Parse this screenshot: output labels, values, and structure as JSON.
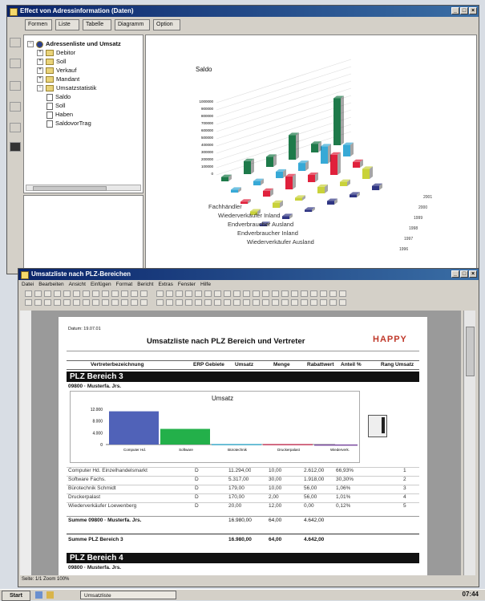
{
  "window1": {
    "title": "Effect von Adressinformation (Daten)",
    "toolbar": [
      "Formen",
      "Liste",
      "Tabelle",
      "Diagramm",
      "Option"
    ],
    "tree": [
      {
        "label": "Adressenliste und Umsatz",
        "level": 0,
        "kind": "root"
      },
      {
        "label": "Debitor",
        "level": 1,
        "kind": "folder"
      },
      {
        "label": "Soll",
        "level": 1,
        "kind": "folder"
      },
      {
        "label": "Verkauf",
        "level": 1,
        "kind": "folder"
      },
      {
        "label": "Mandant",
        "level": 1,
        "kind": "folder"
      },
      {
        "label": "Umsatzstatistik",
        "level": 1,
        "kind": "folder"
      },
      {
        "label": "Saldo",
        "level": 2,
        "kind": "doc"
      },
      {
        "label": "Soll",
        "level": 2,
        "kind": "doc"
      },
      {
        "label": "Haben",
        "level": 2,
        "kind": "doc"
      },
      {
        "label": "SaldovorTrag",
        "level": 2,
        "kind": "doc"
      }
    ],
    "chart3d_title": "Saldo",
    "chart3d_zaxis": [
      "1000000",
      "900000",
      "800000",
      "700000",
      "600000",
      "500000",
      "400000",
      "300000",
      "200000",
      "100000",
      "0"
    ],
    "chart3d_rows": [
      "Fachhändler",
      "Wiederverkäufer Inland",
      "Endverbraucher Ausland",
      "Endverbraucher Inland",
      "Wiederverkäufer Ausland"
    ],
    "chart3d_cols": [
      "1996",
      "1997",
      "1998",
      "1999",
      "2000",
      "2001"
    ],
    "chart3d_colors": [
      "#1e7a4a",
      "#37a9d6",
      "#e0213c",
      "#c9d23a",
      "#2f3583"
    ]
  },
  "window2": {
    "title": "Umsatzliste nach PLZ-Bereichen",
    "menu": [
      "Datei",
      "Bearbeiten",
      "Ansicht",
      "Einfügen",
      "Format",
      "Bericht",
      "Extras",
      "Fenster",
      "Hilfe"
    ],
    "report": {
      "date": "Datum: 19.07.01",
      "title": "Umsatzliste nach PLZ Bereich und Vertreter",
      "logo": "HAPPY",
      "columns": [
        "Vertreterbezeichnung",
        "ERP Gebiete",
        "Umsatz",
        "Menge",
        "Rabattwert",
        "Anteil %",
        "Rang Umsatz"
      ],
      "band1": "PLZ Bereich 3",
      "group1": "09800 · Musterfa. Jrs.",
      "chart_title": "Umsatz",
      "rows": [
        [
          "Computer Hd. Einzelhandelsmarkt",
          "D",
          "11.294,00",
          "10,00",
          "2.612,00",
          "66,93%",
          "1"
        ],
        [
          "Software Fachs.",
          "D",
          "5.317,00",
          "30,00",
          "1.918,00",
          "30,30%",
          "2"
        ],
        [
          "Bürotechnik Schmidt",
          "D",
          "179,00",
          "10,00",
          "56,00",
          "1,06%",
          "3"
        ],
        [
          "Druckerpalast",
          "D",
          "170,00",
          "2,00",
          "56,00",
          "1,01%",
          "4"
        ],
        [
          "Wiederverkäufer Loewenberg",
          "D",
          "20,00",
          "12,00",
          "0,00",
          "0,12%",
          "5"
        ]
      ],
      "sum_group": "Summe 09800 · Musterfa. Jrs.",
      "sum_group_values": [
        "16.980,00",
        "64,00",
        "4.642,00"
      ],
      "sum_band": "Summe PLZ Bereich 3",
      "sum_band_values": [
        "16.980,00",
        "64,00",
        "4.642,00"
      ],
      "band2": "PLZ Bereich 4",
      "group2": "09800 · Musterfa. Jrs."
    },
    "status": "Seite: 1/1   Zoom 100%"
  },
  "taskbar": {
    "start": "Start",
    "items": [
      "Umsatzliste"
    ],
    "clock": "07:44"
  },
  "chart_data": {
    "type": "bar",
    "title": "Umsatz",
    "categories": [
      "Computer Hd.",
      "Software",
      "Bürotechnik",
      "Druckerpalast",
      "Wiederverk."
    ],
    "values": [
      11294,
      5317,
      179,
      170,
      20
    ],
    "colors": [
      "#5062b8",
      "#23b04a",
      "#3aa9c8",
      "#c43a5a",
      "#7b4aa0"
    ],
    "ylabel": "",
    "ylim": [
      0,
      12000
    ],
    "yticks": [
      "12.000",
      "8.000",
      "4.000",
      "0"
    ]
  }
}
